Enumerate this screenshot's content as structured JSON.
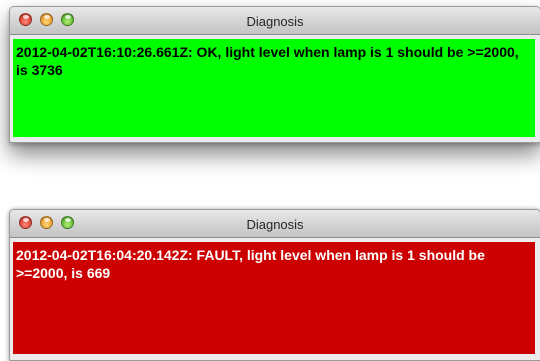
{
  "windows": [
    {
      "title": "Diagnosis",
      "message": "2012-04-02T16:10:26.661Z: OK, light level when lamp is 1 should be >=2000, is 3736",
      "status_color": "#00ff00",
      "text_color": "#000000",
      "controls": [
        "close-button",
        "minimize-button",
        "zoom-button"
      ]
    },
    {
      "title": "Diagnosis",
      "message": "2012-04-02T16:04:20.142Z: FAULT, light level when lamp is 1 should be >=2000, is 669",
      "status_color": "#cc0000",
      "text_color": "#ffffff",
      "controls": [
        "close-button",
        "minimize-button",
        "zoom-button"
      ]
    }
  ]
}
